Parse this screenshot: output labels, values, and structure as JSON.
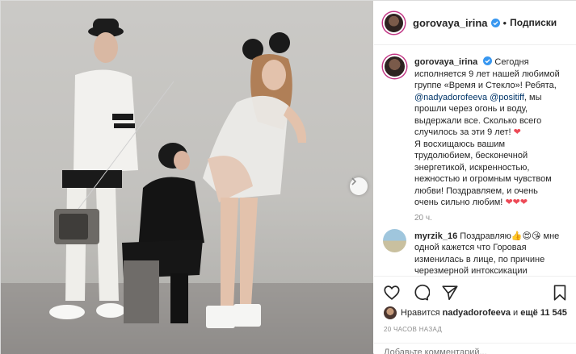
{
  "header": {
    "username": "gorovaya_irina",
    "separator": "•",
    "follow_label": "Подписки"
  },
  "caption": {
    "username": "gorovaya_irina",
    "text_1": "Сегодня исполняется 9 лет нашей любимой группе «Время и Стекло»! Ребята,",
    "mention_1": "@nadyadorofeeva",
    "mention_2": "@positiff",
    "text_2": ", мы прошли через огонь и воду, выдержали все. Сколько всего случилось за эти 9 лет!",
    "heart_1": "❤",
    "text_3": "Я восхищаюсь вашим трудолюбием, бесконечной энергетикой, искренностью, нежностью и огромным чувством любви! Поздравляем, и очень очень сильно любим!",
    "hearts_2": "❤❤❤",
    "time": "20 ч."
  },
  "comment": {
    "username": "myrzik_16",
    "text_1": "Поздравляю👍😍😘",
    "text_2": "мне одной кажется что Горовая изменилась в лице, по причине черезмерной интоксикации алкоголем?",
    "emoji": "😳"
  },
  "likes": {
    "prefix": "Нравится",
    "user": "nadyadorofeeva",
    "and": "и",
    "count": "ещё 11 545"
  },
  "time_ago": "20 ЧАСОВ НАЗАД",
  "add_comment_placeholder": "Добавьте комментарий...",
  "icons": {
    "like": "heart-icon",
    "comment": "comment-icon",
    "share": "share-icon",
    "save": "bookmark-icon",
    "next": "chevron-right-icon",
    "verified": "verified-badge-icon"
  },
  "colors": {
    "verified": "#3897f0",
    "link": "#003569",
    "heart": "#ed4956",
    "meta": "#8e8e8e"
  }
}
